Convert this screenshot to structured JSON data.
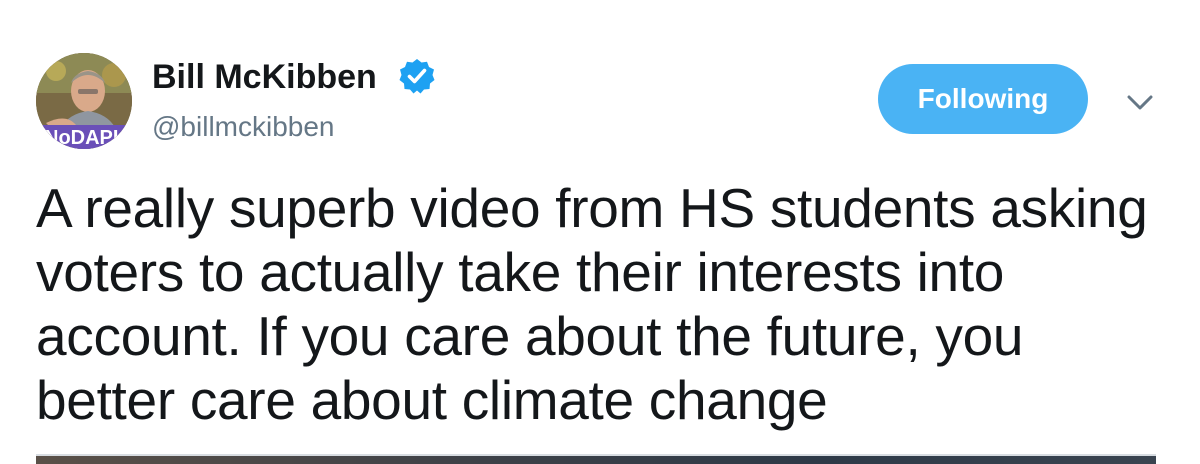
{
  "author": {
    "display_name": "Bill McKibben",
    "username": "@billmckibben",
    "verified": true,
    "avatar_caption": "NoDAPL"
  },
  "actions": {
    "follow_label": "Following",
    "menu_icon": "chevron-down-icon"
  },
  "tweet": {
    "text": "A really superb video from HS students asking voters to actually take their interests into account. If you care about the future, you better care about climate change"
  },
  "colors": {
    "accent": "#4ab3f4",
    "verified": "#1da1f2",
    "secondary_text": "#657786",
    "primary_text": "#14171a"
  }
}
